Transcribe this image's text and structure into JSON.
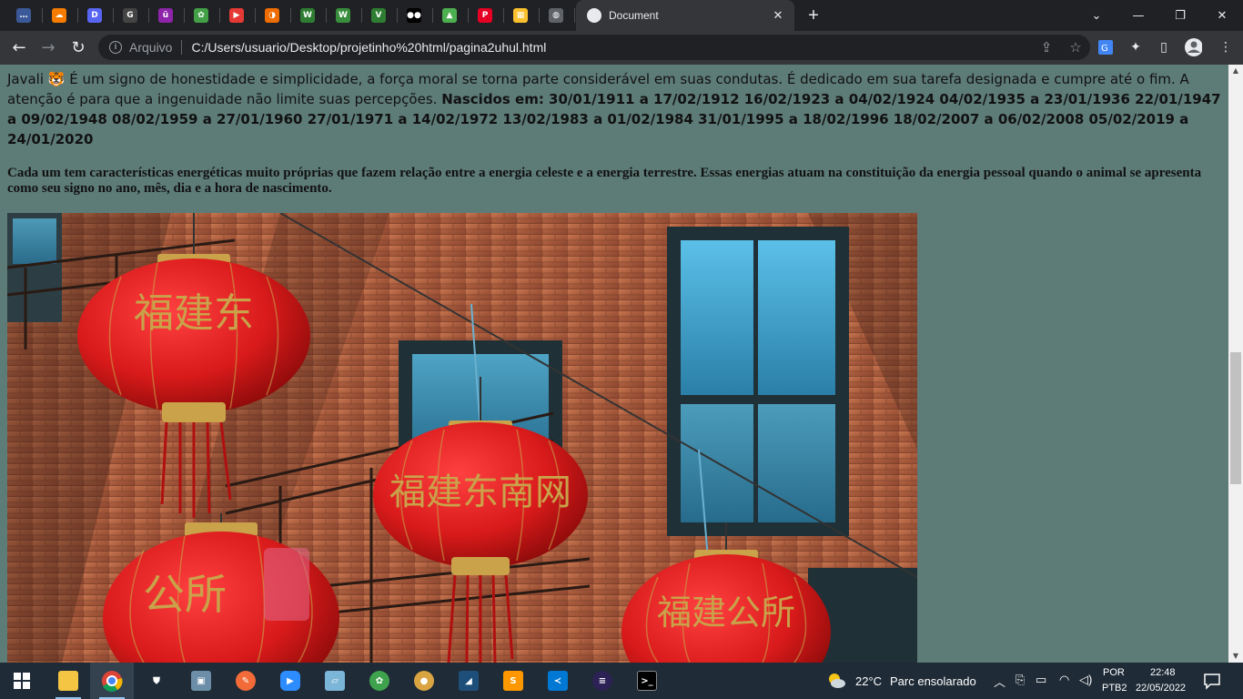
{
  "browser": {
    "pinned_tabs": [
      {
        "name": "tab-generic",
        "glyph": "…",
        "color": "#3b5998"
      },
      {
        "name": "tab-cloud",
        "glyph": "☁",
        "color": "#f57c00"
      },
      {
        "name": "tab-discord",
        "glyph": "D",
        "color": "#5865f2"
      },
      {
        "name": "tab-github",
        "glyph": "G",
        "color": "#444"
      },
      {
        "name": "tab-u",
        "glyph": "ü",
        "color": "#8e24aa"
      },
      {
        "name": "tab-leaf",
        "glyph": "✿",
        "color": "#43a047"
      },
      {
        "name": "tab-youtube",
        "glyph": "▶",
        "color": "#e53935"
      },
      {
        "name": "tab-orange",
        "glyph": "◑",
        "color": "#ef6c00"
      },
      {
        "name": "tab-w1",
        "glyph": "W",
        "color": "#2e7d32"
      },
      {
        "name": "tab-w2",
        "glyph": "W",
        "color": "#388e3c"
      },
      {
        "name": "tab-v",
        "glyph": "V",
        "color": "#2e7d32"
      },
      {
        "name": "tab-medium",
        "glyph": "●●",
        "color": "#000"
      },
      {
        "name": "tab-android",
        "glyph": "▲",
        "color": "#4caf50"
      },
      {
        "name": "tab-pinterest",
        "glyph": "P",
        "color": "#e60023"
      },
      {
        "name": "tab-colors",
        "glyph": "▦",
        "color": "#fbc02d"
      },
      {
        "name": "tab-globe",
        "glyph": "◍",
        "color": "#5f6368"
      }
    ],
    "active_tab_title": "Document",
    "omnibox_scheme": "Arquivo",
    "omnibox_url": "C:/Users/usuario/Desktop/projetinho%20html/pagina2uhul.html"
  },
  "page": {
    "para1_text": "Javali 🐯 É um signo de honestidade e simplicidade, a força moral se torna parte considerável em suas condutas. É dedicado em sua tarefa designada e cumpre até o fim. A atenção é para que a ingenuidade não limite suas percepções. ",
    "para1_bold": "Nascidos em: 30/01/1911 a 17/02/1912 16/02/1923 a 04/02/1924 04/02/1935 a 23/01/1936 22/01/1947 a 09/02/1948 08/02/1959 a 27/01/1960 27/01/1971 a 14/02/1972 13/02/1983 a 01/02/1984 31/01/1995 a 18/02/1996 18/02/2007 a 06/02/2008 05/02/2019 a 24/01/2020",
    "para2_text": "Cada um tem características energéticas muito próprias que fazem relação entre a energia celeste e a energia terrestre. Essas energias atuam na constituição da energia pessoal quando o animal se apresenta como seu signo no ano, mês, dia e a hora de nascimento.",
    "lantern_chars": {
      "l1": "福建东",
      "l2": "福建东南网",
      "l3": "公所",
      "l4": "福建公所"
    }
  },
  "taskbar": {
    "weather_temp": "22°C",
    "weather_desc": "Parc ensolarado",
    "lang_top": "POR",
    "lang_bottom": "PTB2",
    "time": "22:48",
    "date": "22/05/2022"
  }
}
